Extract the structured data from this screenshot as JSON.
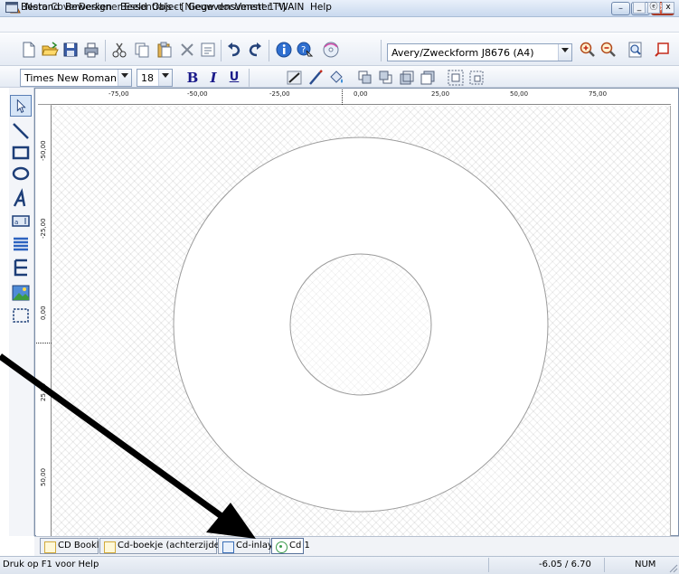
{
  "window": {
    "title": "Nero CoverDesigner Essentials - [Nieuw document 1 *]",
    "controls": {
      "minimize": "–",
      "maximize": "□",
      "close": "✕"
    },
    "mdi_controls": {
      "minimize": "_",
      "restore": "ⓔ",
      "close": "x"
    }
  },
  "menu": [
    "Bestand",
    "Bewerken",
    "Beeld",
    "Object",
    "Gegevens",
    "Venster",
    "TWAIN",
    "Help"
  ],
  "toolbar": {
    "paper_template": "Avery/Zweckform J8676 (A4)",
    "font_family": "Times New Roman",
    "font_size": "18",
    "bold_glyph": "B",
    "italic_glyph": "I",
    "underline_glyph": "U"
  },
  "ruler": {
    "horizontal": [
      "-75,00",
      "-50,00",
      "-25,00",
      "0,00",
      "25,00",
      "50,00",
      "75,00"
    ],
    "vertical": [
      "-50,00",
      "-25,00",
      "0,00",
      "25,00",
      "50,00"
    ]
  },
  "tabs": [
    {
      "label": "CD Booklet",
      "active": false
    },
    {
      "label": "Cd-boekje (achterzijde)",
      "active": false
    },
    {
      "label": "Cd-inlay",
      "active": false
    },
    {
      "label": "Cd 1",
      "active": true
    }
  ],
  "status": {
    "help_text": "Druk op F1 voor Help",
    "coordinates": "-6.05 / 6.70",
    "num_lock": "NUM"
  },
  "colors": {
    "title_gradient_top": "#e9f0fa",
    "accent": "#3a6fb8",
    "close_button": "#c7432a"
  }
}
